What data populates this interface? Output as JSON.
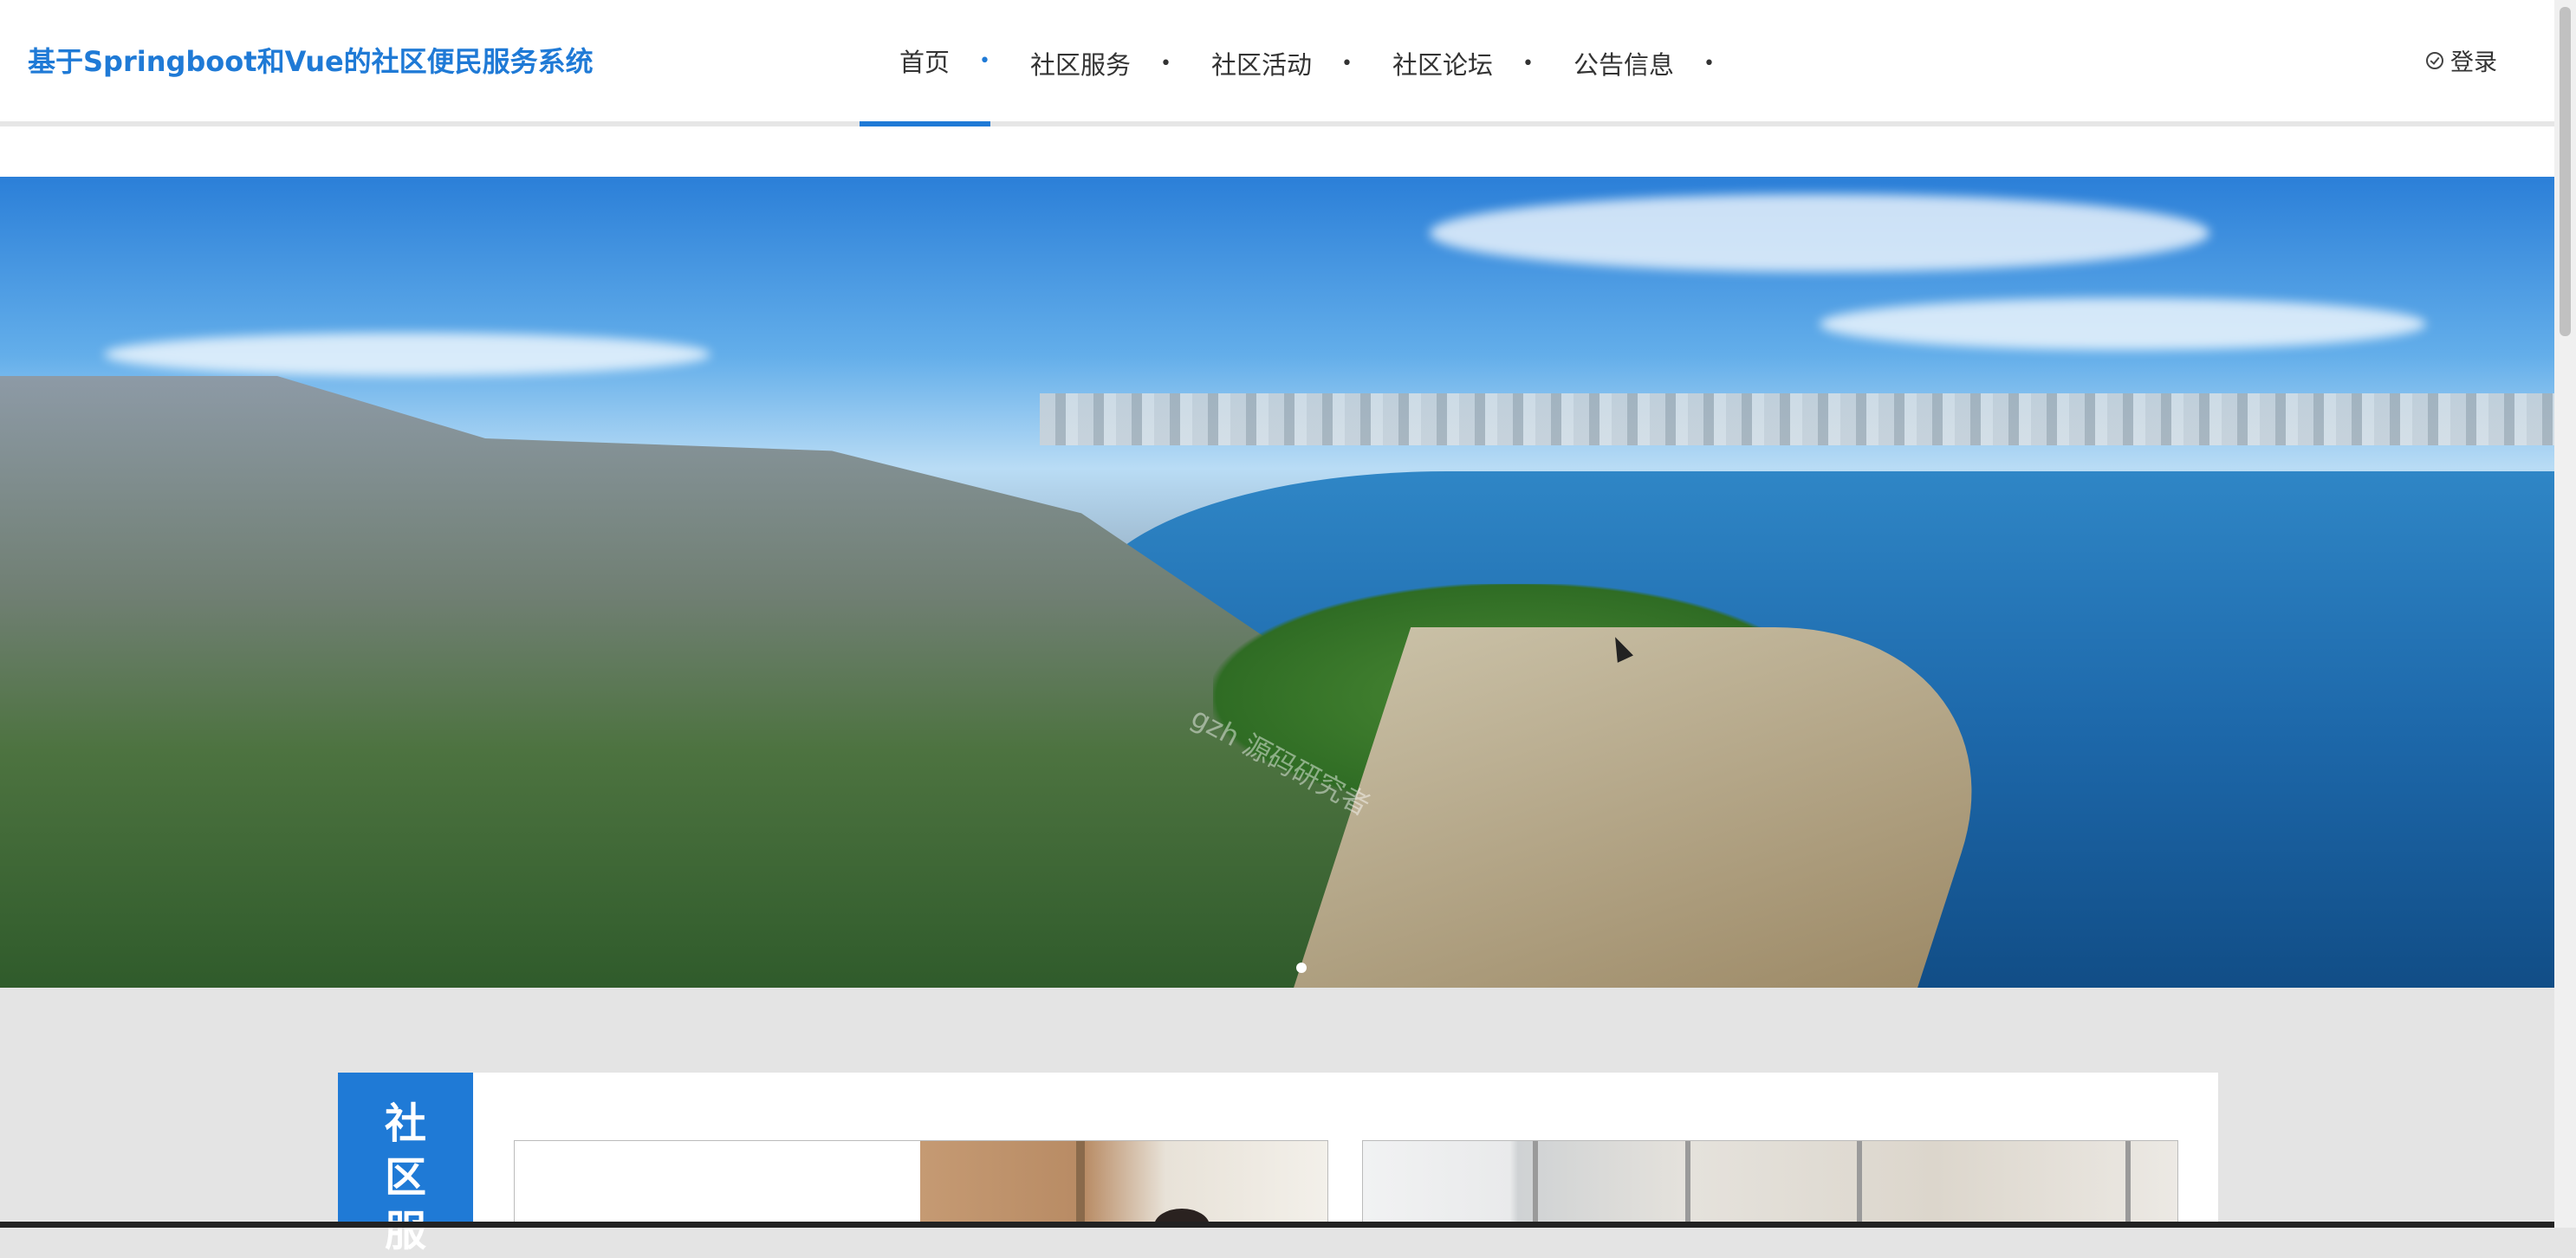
{
  "header": {
    "site_title": "基于Springboot和Vue的社区便民服务系统",
    "login_label": "登录",
    "nav": [
      {
        "label": "首页",
        "active": true
      },
      {
        "label": "社区服务",
        "active": false
      },
      {
        "label": "社区活动",
        "active": false
      },
      {
        "label": "社区论坛",
        "active": false
      },
      {
        "label": "公告信息",
        "active": false
      }
    ],
    "nav_separator": "•"
  },
  "banner": {
    "watermark": "gzh 源码研究者",
    "slide_indicator_count": 1
  },
  "section": {
    "title_chars": [
      "社",
      "区",
      "服"
    ]
  },
  "colors": {
    "accent": "#1f7ad6",
    "page_bg": "#e4e4e4",
    "header_bg": "#ffffff"
  },
  "icons": {
    "login": "check-circle-icon"
  }
}
